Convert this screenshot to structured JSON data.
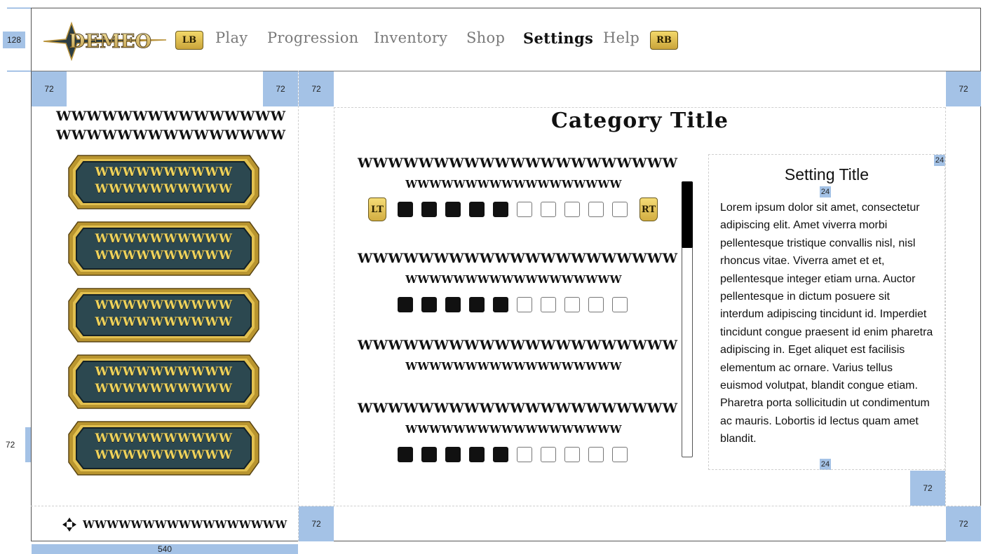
{
  "annotations": {
    "header_height": "128",
    "left_width": "540",
    "pad_72": "72",
    "pad_24": "24"
  },
  "nav": {
    "logo_text": "DEMEO",
    "left_bumper": "LB",
    "right_bumper": "RB",
    "items": [
      {
        "label": "Play",
        "active": false
      },
      {
        "label": "Progression",
        "active": false
      },
      {
        "label": "Inventory",
        "active": false
      },
      {
        "label": "Shop",
        "active": false
      },
      {
        "label": "Settings",
        "active": true
      },
      {
        "label": "Help",
        "active": false
      }
    ]
  },
  "sidebar": {
    "heading_line1": "WWWWWWWWWWWWWWW",
    "heading_line2": "WWWWWWWWWWWWWWW",
    "buttons": [
      {
        "line1": "WWWWWWWWWW",
        "line2": "WWWWWWWWWW"
      },
      {
        "line1": "WWWWWWWWWW",
        "line2": "WWWWWWWWWW"
      },
      {
        "line1": "WWWWWWWWWW",
        "line2": "WWWWWWWWWW"
      },
      {
        "line1": "WWWWWWWWWW",
        "line2": "WWWWWWWWWW"
      },
      {
        "line1": "WWWWWWWWWW",
        "line2": "WWWWWWWWWW"
      }
    ],
    "footer_hint": "WWWWWWWWWWWWWWWWW"
  },
  "category": {
    "title": "Category Title",
    "trigger_left": "LT",
    "trigger_right": "RT",
    "settings": [
      {
        "name": "WWWWWWWWWWWWWWWWWWWWW",
        "value": "WWWWWWWWWWWWWWWWWW",
        "level": 5,
        "max": 10,
        "has_triggers": true,
        "has_boxes": true
      },
      {
        "name": "WWWWWWWWWWWWWWWWWWWWW",
        "value": "WWWWWWWWWWWWWWWWWW",
        "level": 5,
        "max": 10,
        "has_triggers": false,
        "has_boxes": true
      },
      {
        "name": "WWWWWWWWWWWWWWWWWWWWW",
        "value": "WWWWWWWWWWWWWWWWWW",
        "level": 0,
        "max": 0,
        "has_triggers": false,
        "has_boxes": false
      },
      {
        "name": "WWWWWWWWWWWWWWWWWWWWW",
        "value": "WWWWWWWWWWWWWWWWWW",
        "level": 5,
        "max": 10,
        "has_triggers": false,
        "has_boxes": true
      }
    ],
    "scroll_fraction": 0.24
  },
  "description": {
    "title": "Setting Title",
    "body": "Lorem ipsum dolor sit amet, consectetur adipiscing elit. Amet viverra morbi pellentesque tristique convallis nisl, nisl rhoncus vitae. Viverra amet et et, pellentesque integer etiam urna. Auctor pellentesque in dictum posuere sit interdum adipiscing tincidunt id. Imperdiet tincidunt congue praesent id enim pharetra adipiscing in. Eget aliquet est facilisis elementum ac ornare. Varius tellus euismod volutpat, blandit congue etiam. Pharetra porta sollicitudin ut condimentum ac mauris. Lobortis id lectus quam amet blandit."
  },
  "colors": {
    "accent_gold": "#e2c04f",
    "stone_teal": "#2c4850",
    "annotation_blue": "#a4c2e6"
  }
}
